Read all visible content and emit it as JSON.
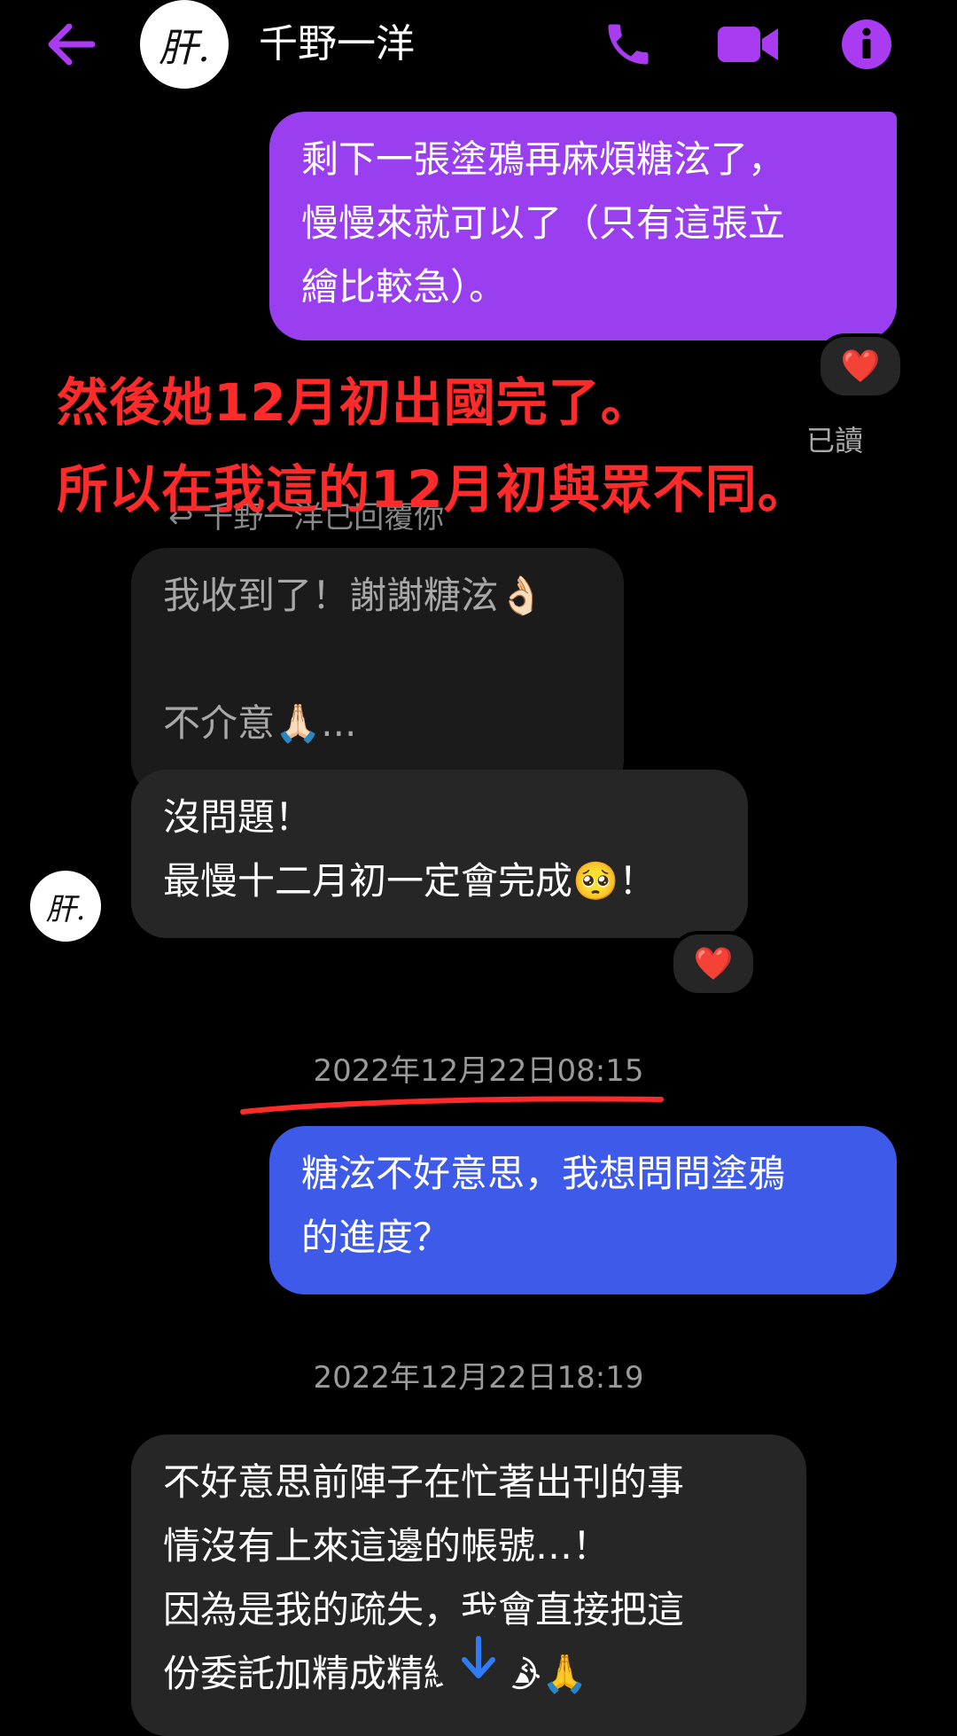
{
  "header": {
    "contact_name": "千野一洋",
    "avatar_text": "肝."
  },
  "messages": {
    "outgoing_1": "剩下一張塗鴉再麻煩糖泫了，\n慢慢來就可以了（只有這張立\n繪比較急）。",
    "reaction_1": "❤️",
    "read_status": "已讀",
    "reply_hint": "千野一洋已回覆你",
    "quoted_reply": "我收到了！謝謝糖泫👌🏻\n\n不介意🙏🏻...",
    "incoming_1": "沒問題！\n最慢十二月初一定會完成🥺！",
    "reaction_2": "❤️",
    "timestamp_1": "2022年12月22日08:15",
    "outgoing_2": "糖泫不好意思，我想問問塗鴉\n的進度？",
    "timestamp_2": "2022年12月22日18:19",
    "incoming_2": "不好意思前陣子在忙著出刊的事\n情沒有上來這邊的帳號…！\n因為是我的疏失，我會直接把這\n份委託加精成精緻的😭🙏"
  },
  "annotations": {
    "line_1": "然後她12月初出國完了。",
    "line_2": "所以在我這的12月初與眾不同。"
  },
  "colors": {
    "accent_purple": "#9a3ff0",
    "outgoing_blue": "#3d5be8",
    "incoming_gray": "#262626",
    "annotation_red": "#ff2a2a",
    "icon_purple": "#a93cf0"
  },
  "icons": {
    "back": "arrow-left-icon",
    "call": "phone-icon",
    "video": "video-camera-icon",
    "info": "info-icon",
    "scroll": "arrow-down-icon"
  }
}
